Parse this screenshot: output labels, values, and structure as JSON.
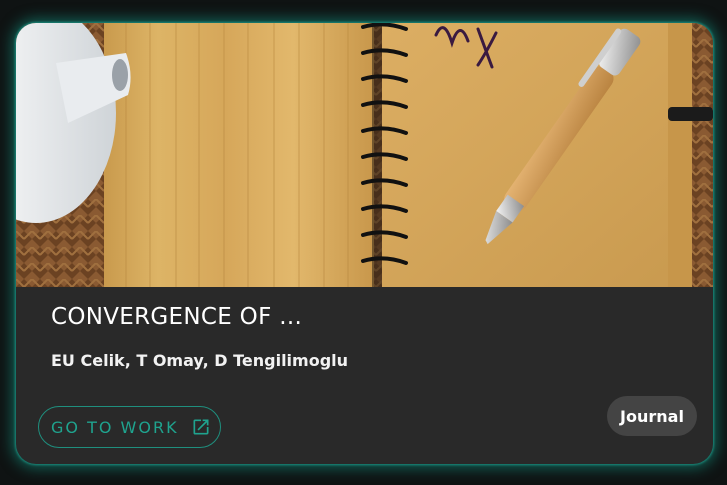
{
  "card": {
    "image_alt": "Spiral notebook with bamboo cover and wooden pen",
    "image_icon": "notebook-photo",
    "title": "CONVERGENCE OF ...",
    "authors": "EU Celik, T Omay, D Tengilimoglu",
    "action": {
      "label": "GO TO WORK",
      "icon": "external-link-icon"
    },
    "type_badge": "Journal"
  },
  "colors": {
    "card_background": "#292929",
    "page_background": "#0f1313",
    "accent": "#1fa38e",
    "glow": "#14a08c",
    "badge_background": "#444444"
  }
}
